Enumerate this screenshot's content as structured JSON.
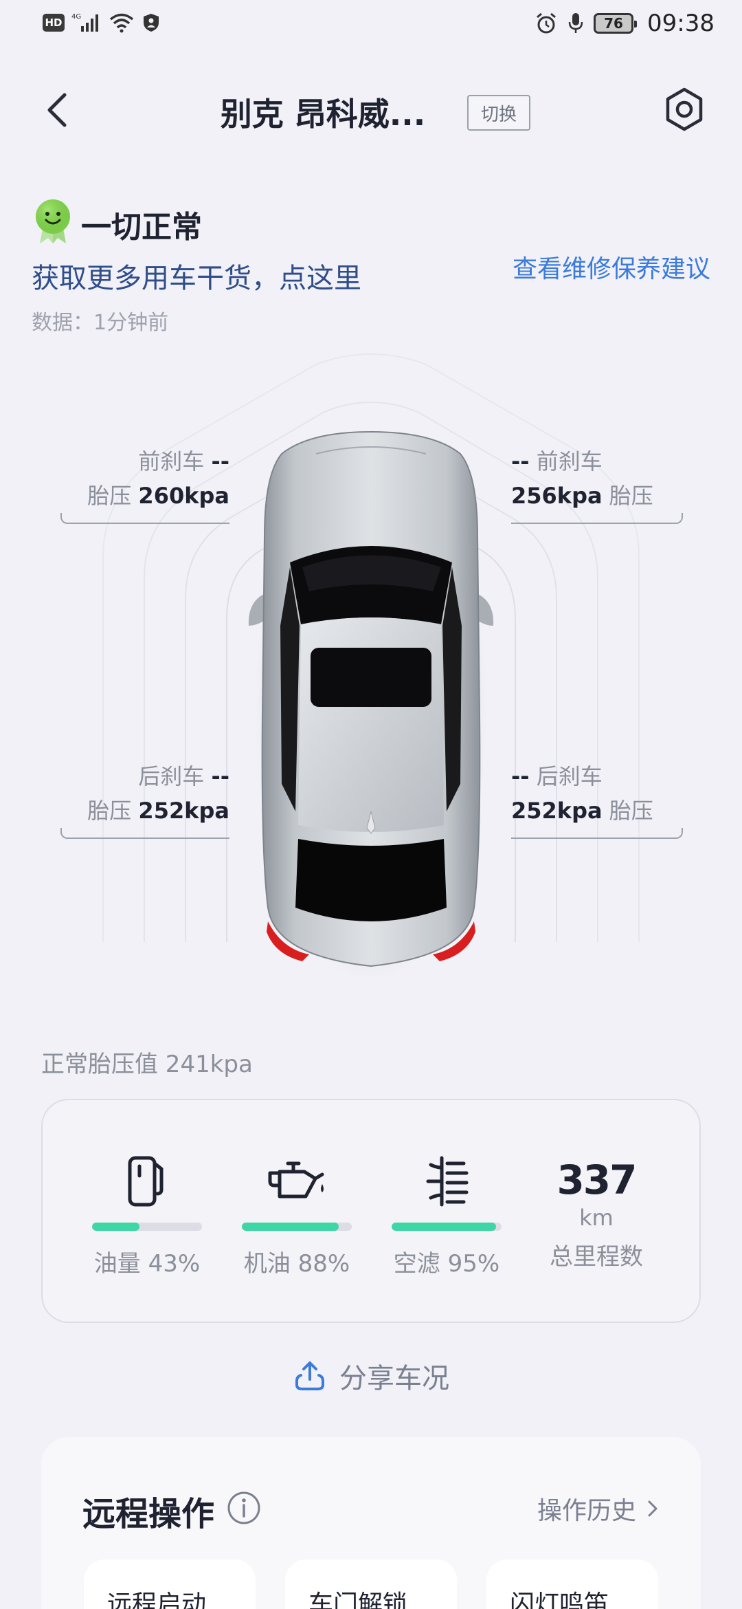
{
  "status_bar": {
    "hd": "HD",
    "network": "4G",
    "battery": "76",
    "time": "09:38"
  },
  "header": {
    "title": "别克 昂科威...",
    "switch_label": "切换"
  },
  "summary": {
    "status": "一切正常",
    "promo": "获取更多用车干货，点这里",
    "advice_link": "查看维修保养建议",
    "data_time": "数据：1分钟前"
  },
  "tires": {
    "front_left": {
      "brake_label": "前刹车",
      "brake_value": "--",
      "pressure_label": "胎压",
      "pressure_value": "260kpa"
    },
    "front_right": {
      "brake_label": "前刹车",
      "brake_value": "--",
      "pressure_label": "胎压",
      "pressure_value": "256kpa"
    },
    "rear_left": {
      "brake_label": "后刹车",
      "brake_value": "--",
      "pressure_label": "胎压",
      "pressure_value": "252kpa"
    },
    "rear_right": {
      "brake_label": "后刹车",
      "brake_value": "--",
      "pressure_label": "胎压",
      "pressure_value": "252kpa"
    }
  },
  "normal_pressure": "正常胎压值 241kpa",
  "stats": {
    "fuel": {
      "label": "油量 43%",
      "level": 0.43,
      "icon": "fuel-pump-icon"
    },
    "oil": {
      "label": "机油 88%",
      "level": 0.88,
      "icon": "oil-can-icon"
    },
    "air_filter": {
      "label": "空滤 95%",
      "level": 0.95,
      "icon": "air-filter-icon"
    },
    "mileage": {
      "value": "337",
      "unit": "km",
      "label": "总里程数"
    },
    "bar_color": "#3fd6a6"
  },
  "share_label": "分享车况",
  "remote": {
    "title": "远程操作",
    "history": "操作历史",
    "buttons": [
      "远程启动",
      "车门解锁",
      "闪灯鸣笛"
    ]
  },
  "colors": {
    "accent_link": "#3a7bdc",
    "promo_text": "#2f4d8a",
    "ok_green": "#7ccc4a"
  }
}
